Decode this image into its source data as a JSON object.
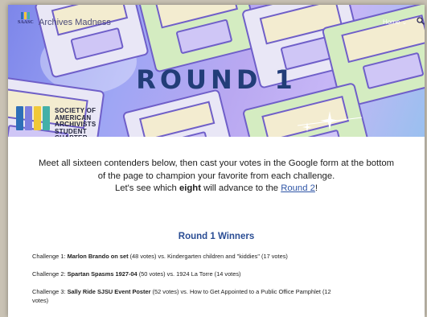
{
  "header": {
    "site_title": "Archives Madness",
    "logo_text": "SAASC",
    "nav_home": "Home",
    "nav_home_chevron": "⌄",
    "search_icon": "search-icon"
  },
  "banner": {
    "title": "ROUND 1",
    "org_line1": "SOCIETY OF AMERICAN",
    "org_line2": "ARCHIVISTS",
    "org_line3": "STUDENT CHAPTER",
    "colors": {
      "title": "#223d78",
      "book1": "#2e6fb8",
      "book2": "#7e7fe0",
      "book3": "#f0c838",
      "book4": "#43b0a8"
    }
  },
  "intro": {
    "line1": "Meet all sixteen contenders below, then cast your votes in the Google form at the bottom",
    "line2": "of the page to champion your favorite from each challenge.",
    "line3_prefix": "Let's see which ",
    "line3_bold": "eight",
    "line3_middle": " will advance to the ",
    "line3_link": "Round 2",
    "line3_suffix": "!"
  },
  "winners": {
    "title": "Round 1 Winners",
    "challenges": [
      {
        "prefix": "Challenge 1: ",
        "winner": "Marlon Brando on set",
        "rest": " (48 votes) vs. Kindergarten children and \"kiddies\" (17 votes)"
      },
      {
        "prefix": "Challenge 2: ",
        "winner": "Spartan Spasms 1927-04",
        "rest": " (50 votes) vs. 1924 La Torre (14 votes)"
      },
      {
        "prefix": "Challenge 3: ",
        "winner": "Sally Ride SJSU Event Poster",
        "rest": " (52 votes) vs. How to Get Appointed to a Public Office Pamphlet (12",
        "rest2": "votes)"
      }
    ]
  }
}
